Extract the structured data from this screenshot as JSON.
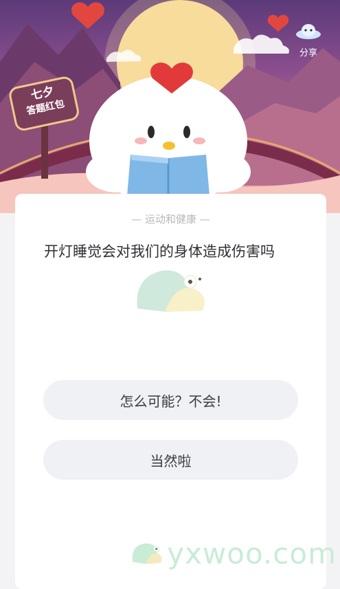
{
  "banner": {
    "sign_line1": "七夕",
    "sign_line2": "答题红包",
    "share_label": "分享",
    "colors": {
      "sky_top": "#5b3a79",
      "moon": "#f7dd9c",
      "heart": "#e23a3a"
    }
  },
  "quiz": {
    "category": "运动和健康",
    "question": "开灯睡觉会对我们的身体造成伤害吗",
    "options": [
      {
        "label": "怎么可能？不会!"
      },
      {
        "label": "当然啦"
      }
    ]
  },
  "watermark": {
    "text": "yxwoo.com",
    "icon": "snail-icon"
  }
}
